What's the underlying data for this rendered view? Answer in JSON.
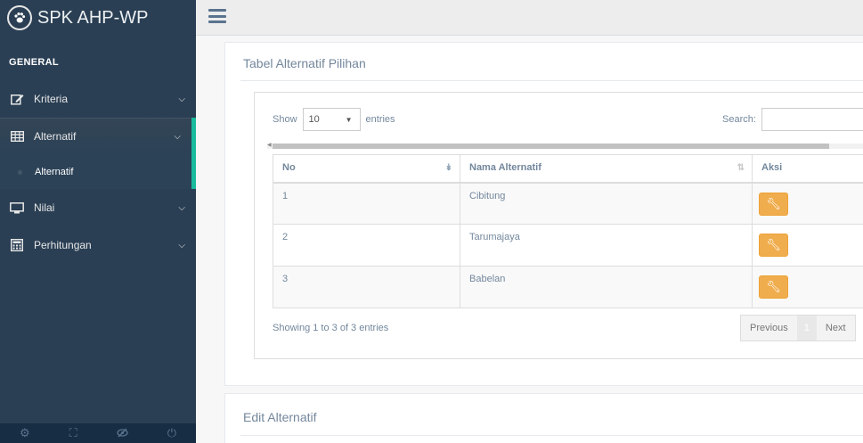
{
  "app": {
    "title": "SPK AHP-WP",
    "logo_icon": "paw-icon"
  },
  "sidebar": {
    "section": "GENERAL",
    "items": [
      {
        "label": "Kriteria",
        "icon": "edit-icon"
      },
      {
        "label": "Alternatif",
        "icon": "table-icon"
      },
      {
        "label": "Nilai",
        "icon": "desktop-icon"
      },
      {
        "label": "Perhitungan",
        "icon": "calculator-icon"
      }
    ],
    "submenu": [
      {
        "label": "Alternatif"
      }
    ],
    "footer_icons": [
      "gear-icon",
      "fullscreen-icon",
      "eye-slash-icon",
      "power-icon"
    ]
  },
  "panel1": {
    "title": "Tabel Alternatif Pilihan",
    "length_label_pre": "Show",
    "length_value": "10",
    "length_label_post": "entries",
    "search_label": "Search:",
    "search_value": "",
    "columns": [
      "No",
      "Nama Alternatif",
      "Aksi"
    ],
    "rows": [
      {
        "no": "1",
        "nama": "Cibitung"
      },
      {
        "no": "2",
        "nama": "Tarumajaya"
      },
      {
        "no": "3",
        "nama": "Babelan"
      }
    ],
    "info": "Showing 1 to 3 of 3 entries",
    "pagination": {
      "previous": "Previous",
      "page": "1",
      "next": "Next"
    }
  },
  "panel2": {
    "title": "Edit Alternatif"
  },
  "colors": {
    "sidebar": "#2a3f54",
    "accent": "#1abb9c",
    "warning": "#f0ad4e"
  }
}
